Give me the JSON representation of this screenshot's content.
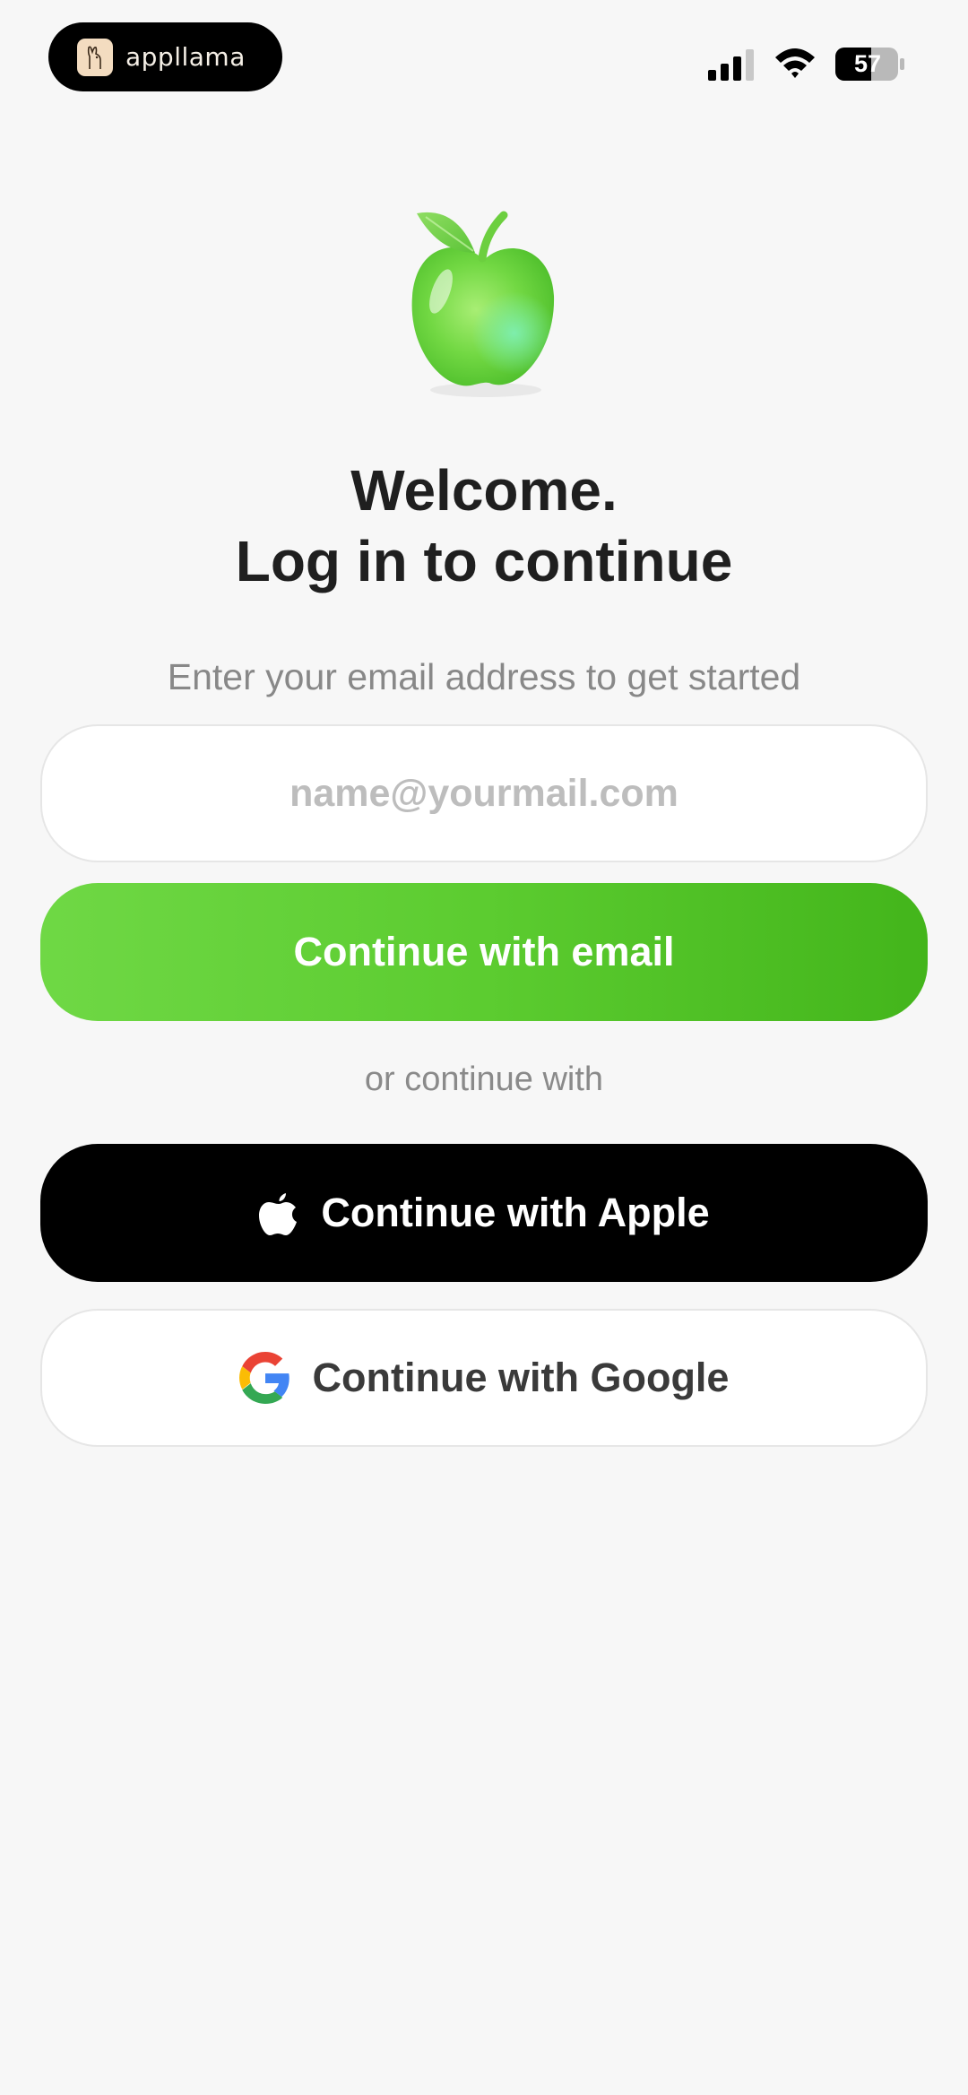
{
  "status_bar": {
    "app_name": "appllama",
    "battery": "57"
  },
  "welcome": {
    "line1": "Welcome.",
    "line2": "Log in to continue"
  },
  "subtitle": "Enter your email address to get started",
  "email_field": {
    "placeholder": "name@yourmail.com",
    "value": ""
  },
  "buttons": {
    "email": "Continue with email",
    "apple": "Continue with Apple",
    "google": "Continue with Google"
  },
  "divider_text": "or continue with",
  "colors": {
    "primary_green": "#5ccc30",
    "background": "#f7f7f7",
    "apple_button": "#000000"
  },
  "icons": {
    "hero": "green-apple-icon",
    "apple": "apple-logo-icon",
    "google": "google-g-icon",
    "app": "llama-icon"
  }
}
